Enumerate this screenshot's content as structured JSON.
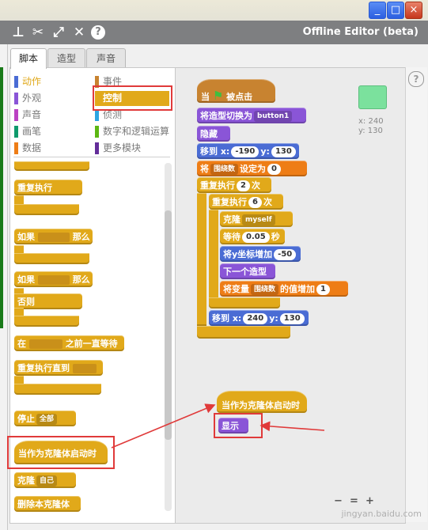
{
  "window": {
    "app_title": "Offline Editor (beta)",
    "controls": [
      "_",
      "□",
      "×"
    ]
  },
  "toolbar": {
    "icons": [
      "stamp-icon",
      "cut-icon",
      "grow-icon",
      "shrink-icon",
      "help-icon"
    ],
    "help": "?"
  },
  "tabs": [
    "脚本",
    "造型",
    "声音"
  ],
  "categories": {
    "left": [
      {
        "label": "动作",
        "color": "#4a6cd4"
      },
      {
        "label": "外观",
        "color": "#8a55d7"
      },
      {
        "label": "声音",
        "color": "#bb42c3"
      },
      {
        "label": "画笔",
        "color": "#0e9a6c"
      },
      {
        "label": "数据",
        "color": "#ee7d16"
      }
    ],
    "right": [
      {
        "label": "事件",
        "color": "#c88330"
      },
      {
        "label": "控制",
        "color": "#e1a91a"
      },
      {
        "label": "侦测",
        "color": "#2ca5e2"
      },
      {
        "label": "数字和逻辑运算",
        "color": "#5cb712"
      },
      {
        "label": "更多模块",
        "color": "#632d99"
      }
    ]
  },
  "palette": {
    "repeat": "重复执行",
    "if_prefix": "如果",
    "if_suffix": "那么",
    "else": "否则",
    "wait_until_prefix": "在",
    "wait_until_suffix": "之前一直等待",
    "repeat_until": "重复执行直到",
    "stop": "停止",
    "stop_opt": "全部",
    "clone_start": "当作为克隆体启动时",
    "clone": "克隆",
    "clone_opt": "自己",
    "delete_clone": "删除本克隆体"
  },
  "stage": {
    "x_label": "x:",
    "x_value": "240",
    "y_label": "y:",
    "y_value": "130"
  },
  "script": {
    "flag_hat_prefix": "当",
    "flag_hat_suffix": "被点击",
    "switch_costume": "将造型切换为",
    "costume_value": "button1",
    "hide": "隐藏",
    "goto": "移到 x:",
    "goto_y": "y:",
    "goto_x1": "-190",
    "goto_y1": "130",
    "set_prefix": "将",
    "set_var": "围绕数",
    "set_mid": "设定为",
    "set_value": "0",
    "repeat": "重复执行",
    "repeat_count": "2",
    "repeat_unit": "次",
    "inner_repeat_count": "6",
    "clone_label": "克隆",
    "clone_target": "myself",
    "wait": "等待",
    "wait_value": "0.05",
    "wait_unit": "秒",
    "change_y": "将y坐标增加",
    "change_y_value": "-50",
    "next_costume": "下一个造型",
    "change_var_prefix": "将变量",
    "change_var": "围绕数",
    "change_var_mid": "的值增加",
    "change_var_value": "1",
    "goto_x2": "240",
    "goto_y2": "130"
  },
  "clone_script": {
    "hat": "当作为克隆体启动时",
    "show": "显示"
  },
  "zoom": {
    "out": "−",
    "reset": "=",
    "in": "+"
  },
  "watermark": "jingyan.baidu.com"
}
